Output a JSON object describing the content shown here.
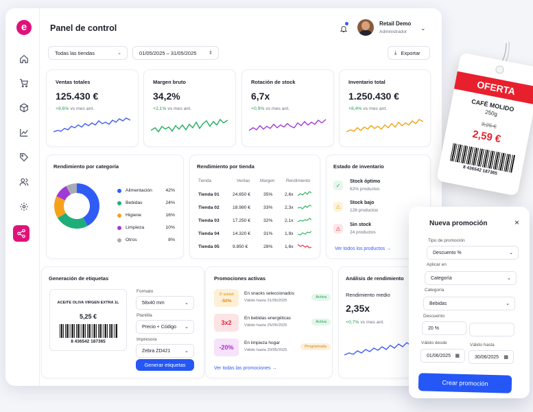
{
  "app": {
    "title": "Panel de control",
    "logo": "e"
  },
  "sidebar": {
    "icons": [
      "home-icon",
      "cart-icon",
      "box-icon",
      "chart-icon",
      "tag-icon",
      "users-icon",
      "gear-icon",
      "share-icon"
    ]
  },
  "user": {
    "name": "Retail Demo",
    "role": "Administrador"
  },
  "filters": {
    "store": "Todas las tiendas",
    "date_range": "01/05/2025 – 31/05/2025",
    "export_label": "Exportar"
  },
  "kpis": [
    {
      "label": "Ventas totales",
      "value": "125.430 €",
      "delta": "+8,6%",
      "delta_suffix": "vs mes ant.",
      "color": "#3b5bf5"
    },
    {
      "label": "Margen bruto",
      "value": "34,2%",
      "delta": "+2,1%",
      "delta_suffix": "vs mes ant.",
      "color": "#1fae5a"
    },
    {
      "label": "Rotación de stock",
      "value": "6,7x",
      "delta": "+0,9%",
      "delta_suffix": "vs mes ant.",
      "color": "#a03ad6"
    },
    {
      "label": "Inventario total",
      "value": "1.250.430 €",
      "delta": "+8,4%",
      "delta_suffix": "vs mes ant.",
      "color": "#f0a21a"
    }
  ],
  "category": {
    "title": "Rendimiento por categoría",
    "items": [
      {
        "name": "Alimentación",
        "pct": "42%",
        "value": 42,
        "color": "#2f5cf5"
      },
      {
        "name": "Bebidas",
        "pct": "24%",
        "value": 24,
        "color": "#1fae7a"
      },
      {
        "name": "Higiene",
        "pct": "16%",
        "value": 16,
        "color": "#f5a21a"
      },
      {
        "name": "Limpieza",
        "pct": "10%",
        "value": 10,
        "color": "#a03ad6"
      },
      {
        "name": "Otros",
        "pct": "8%",
        "value": 8,
        "color": "#a7abb5"
      }
    ]
  },
  "stores": {
    "title": "Rendimiento por tienda",
    "headers": [
      "Tienda",
      "Ventas",
      "Margen",
      "Rendimiento"
    ],
    "rows": [
      {
        "name": "Tienda 01",
        "sales": "24.650 €",
        "margin": "35%",
        "perf": "2,6x",
        "color": "#1fae5a"
      },
      {
        "name": "Tienda 02",
        "sales": "18.980 €",
        "margin": "33%",
        "perf": "2,3x",
        "color": "#1fae5a"
      },
      {
        "name": "Tienda 03",
        "sales": "17.250 €",
        "margin": "32%",
        "perf": "2,1x",
        "color": "#1fae5a"
      },
      {
        "name": "Tienda 04",
        "sales": "14.320 €",
        "margin": "31%",
        "perf": "1,9x",
        "color": "#1fae5a"
      },
      {
        "name": "Tienda 05",
        "sales": "9.850 €",
        "margin": "28%",
        "perf": "1,6x",
        "color": "#e0283c"
      }
    ]
  },
  "inventory": {
    "title": "Estado de inventario",
    "items": [
      {
        "name": "Stock óptimo",
        "sub": "62% productos",
        "icon": "check-icon",
        "color": "#1fae5a",
        "bg": "#e5f6ec"
      },
      {
        "name": "Stock bajo",
        "sub": "128 productos",
        "icon": "warning-icon",
        "color": "#f0a21a",
        "bg": "#fdf2dc"
      },
      {
        "name": "Sin stock",
        "sub": "24 productos",
        "icon": "alert-icon",
        "color": "#e0283c",
        "bg": "#fde6e8"
      }
    ],
    "link": "Ver todos los productos"
  },
  "labels": {
    "title": "Generación de etiquetas",
    "preview_product": "ACEITE OLIVA VIRGEN EXTRA 1L",
    "preview_price": "5,25 €",
    "barcode": "8 436542 187365",
    "format_label": "Formato",
    "format_value": "58x40 mm",
    "template_label": "Plantilla",
    "template_value": "Precio + Código",
    "printer_label": "Impresora",
    "printer_value": "Zebra ZD421",
    "generate_label": "Generar etiquetas"
  },
  "promotions": {
    "title": "Promociones activas",
    "items": [
      {
        "badge_top": "2ª unidad",
        "badge_main": "-50%",
        "title": "En snacks seleccionados",
        "sub": "Válido hasta 31/05/2025",
        "status": "Activa",
        "bg": "#fdf0d6",
        "fg": "#e08a10",
        "status_bg": "#e3f6ea",
        "status_fg": "#1f9d55"
      },
      {
        "badge_top": "",
        "badge_main": "3x2",
        "title": "En bebidas energéticas",
        "sub": "Válido hasta 25/05/2025",
        "status": "Activa",
        "bg": "#fde3e5",
        "fg": "#e0283c",
        "status_bg": "#e3f6ea",
        "status_fg": "#1f9d55"
      },
      {
        "badge_top": "",
        "badge_main": "-20%",
        "title": "En limpieza hogar",
        "sub": "Válido hasta 20/05/2025",
        "status": "Programada",
        "bg": "#f6e2fb",
        "fg": "#b02ad6",
        "status_bg": "#fdefd8",
        "status_fg": "#d98210"
      }
    ],
    "link": "Ver todas las promociones"
  },
  "analysis": {
    "title": "Análisis de rendimiento",
    "metric": "Rendimiento medio",
    "value": "2,35x",
    "delta": "+0,7%",
    "delta_suffix": "vs mes ant."
  },
  "price_tag": {
    "banner": "OFERTA",
    "product": "CAFÉ MOLIDO",
    "weight": "250g",
    "old_price": "3,25 €",
    "new_price": "2,59 €",
    "barcode": "8 436542 187365"
  },
  "modal": {
    "title": "Nueva promoción",
    "type_label": "Tipo de promoción",
    "type_value": "Descuento %",
    "apply_label": "Aplicar en",
    "apply_value": "Categoría",
    "category_label": "Categoría",
    "category_value": "Bebidas",
    "discount_label": "Descuento",
    "discount_value": "20 %",
    "from_label": "Válido desde",
    "from_value": "01/06/2025",
    "to_label": "Válido hasta",
    "to_value": "30/06/2025",
    "create_label": "Crear promoción"
  }
}
